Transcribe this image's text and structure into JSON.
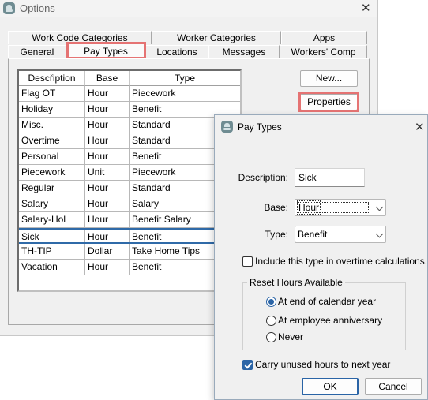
{
  "options_window": {
    "title": "Options",
    "tabs_row1": [
      "Work Code Categories",
      "Worker Categories",
      "Apps"
    ],
    "tabs_row2": [
      "General",
      "Pay Types",
      "Locations",
      "Messages",
      "Workers' Comp"
    ],
    "selected_tab": "Pay Types",
    "grid": {
      "columns": [
        "Description",
        "Base",
        "Type"
      ],
      "rows": [
        [
          "Flag OT",
          "Hour",
          "Piecework"
        ],
        [
          "Holiday",
          "Hour",
          "Benefit"
        ],
        [
          "Misc.",
          "Hour",
          "Standard"
        ],
        [
          "Overtime",
          "Hour",
          "Standard"
        ],
        [
          "Personal",
          "Hour",
          "Benefit"
        ],
        [
          "Piecework",
          "Unit",
          "Piecework"
        ],
        [
          "Regular",
          "Hour",
          "Standard"
        ],
        [
          "Salary",
          "Hour",
          "Salary"
        ],
        [
          "Salary-Hol",
          "Hour",
          "Benefit Salary"
        ],
        [
          "Sick",
          "Hour",
          "Benefit"
        ],
        [
          "TH-TIP",
          "Dollar",
          "Take Home Tips"
        ],
        [
          "Vacation",
          "Hour",
          "Benefit"
        ]
      ],
      "selected_row": "Sick"
    },
    "buttons": {
      "new": "New...",
      "properties": "Properties"
    }
  },
  "dialog": {
    "title": "Pay Types",
    "description_label": "Description:",
    "description_value": "Sick",
    "base_label": "Base:",
    "base_value": "Hour",
    "type_label": "Type:",
    "type_value": "Benefit",
    "overtime_checkbox": {
      "label": "Include this type in overtime calculations.",
      "checked": false
    },
    "reset_group": {
      "title": "Reset Hours Available",
      "options": [
        "At end of calendar year",
        "At employee anniversary",
        "Never"
      ],
      "selected": "At end of calendar year"
    },
    "carry_checkbox": {
      "label": "Carry unused hours to next year",
      "checked": true
    },
    "ok_label": "OK",
    "cancel_label": "Cancel"
  },
  "colors": {
    "highlight": "#e57373",
    "accent": "#2a64a6",
    "selection_border": "#2f6aa8"
  },
  "icons": {
    "app": "users-icon",
    "close": "close-icon",
    "dropdown": "chevron-down-icon",
    "sort": "sort-indicator-icon"
  }
}
